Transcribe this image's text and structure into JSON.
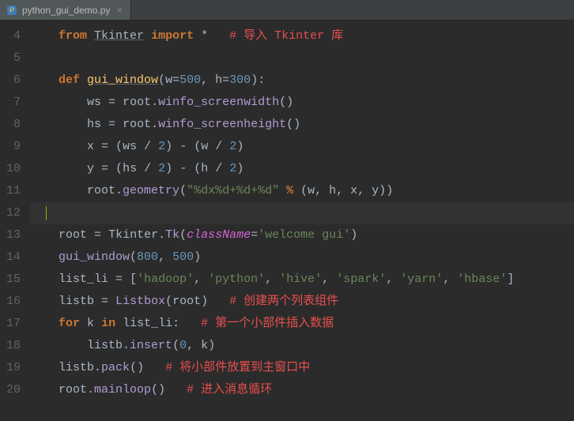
{
  "tab": {
    "filename": "python_gui_demo.py",
    "close_glyph": "×"
  },
  "gutter": {
    "start": 4,
    "end": 20
  },
  "code": {
    "l4": {
      "from": "from",
      "mod": "Tkinter",
      "import": "import",
      "star": "*",
      "comment": "# 导入 Tkinter 库"
    },
    "l6": {
      "def": "def",
      "name": "gui_window",
      "p1": "w",
      "eq": "=",
      "v1": "500",
      "p2": "h",
      "v2": "300"
    },
    "l7": {
      "lhs": "ws",
      "eq": "=",
      "obj": "root",
      "method": "winfo_screenwidth"
    },
    "l8": {
      "lhs": "hs",
      "eq": "=",
      "obj": "root",
      "method": "winfo_screenheight"
    },
    "l9": {
      "lhs": "x",
      "eq": "=",
      "a": "ws",
      "div": "/",
      "two": "2",
      "minus": "-",
      "b": "w"
    },
    "l10": {
      "lhs": "y",
      "eq": "=",
      "a": "hs",
      "div": "/",
      "two": "2",
      "minus": "-",
      "b": "h"
    },
    "l11": {
      "obj": "root",
      "method": "geometry",
      "fmt": "\"%dx%d+%d+%d\"",
      "pct": "%",
      "args": "(w, h, x, y)"
    },
    "l13": {
      "lhs": "root",
      "eq": "=",
      "mod": "Tkinter",
      "cls": "Tk",
      "kw": "className",
      "val": "'welcome gui'"
    },
    "l14": {
      "fn": "gui_window",
      "a1": "800",
      "a2": "500"
    },
    "l15": {
      "lhs": "list_li",
      "eq": "=",
      "s1": "'hadoop'",
      "s2": "'python'",
      "s3": "'hive'",
      "s4": "'spark'",
      "s5": "'yarn'",
      "s6": "'hbase'"
    },
    "l16": {
      "lhs": "listb",
      "eq": "=",
      "cls": "Listbox",
      "arg": "root",
      "comment": "# 创建两个列表组件"
    },
    "l17": {
      "for": "for",
      "var": "k",
      "in": "in",
      "iter": "list_li",
      "comment": "# 第一个小部件插入数据"
    },
    "l18": {
      "obj": "listb",
      "method": "insert",
      "a1": "0",
      "a2": "k"
    },
    "l19": {
      "obj": "listb",
      "method": "pack",
      "comment": "# 将小部件放置到主窗口中"
    },
    "l20": {
      "obj": "root",
      "method": "mainloop",
      "comment": "# 进入消息循环"
    }
  }
}
